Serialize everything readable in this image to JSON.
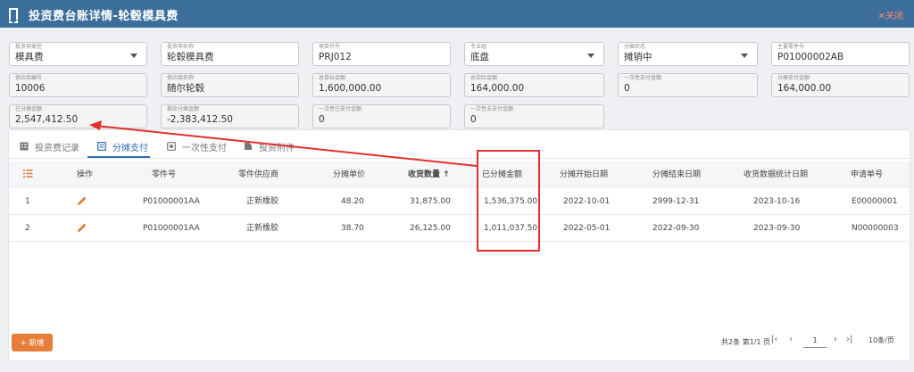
{
  "window": {
    "title": "投资费台账详情-轮毂模具费",
    "close_label": "✕关闭"
  },
  "form": {
    "row1": [
      {
        "label": "投资项类型",
        "value": "模具费",
        "dropdown": true
      },
      {
        "label": "投资项名称",
        "value": "轮毂模具费",
        "dropdown": false
      },
      {
        "label": "项目代号",
        "value": "PRJ012",
        "dropdown": false
      },
      {
        "label": "专业组",
        "value": "底盘",
        "dropdown": true
      },
      {
        "label": "分摊状态",
        "value": "摊销中",
        "dropdown": true
      },
      {
        "label": "主要零件号",
        "value": "P01000002AB",
        "dropdown": false
      }
    ],
    "row2": [
      {
        "label": "供应商编号",
        "value": "10006"
      },
      {
        "label": "供应商名称",
        "value": "随尔轮毂"
      },
      {
        "label": "总目标金额",
        "value": "1,600,000.00"
      },
      {
        "label": "总实际金额",
        "value": "164,000.00"
      },
      {
        "label": "一次性支付金额",
        "value": "0"
      },
      {
        "label": "分摊支付金额",
        "value": "164,000.00"
      }
    ],
    "row3": [
      {
        "label": "已分摊金额",
        "value": "2,547,412.50"
      },
      {
        "label": "剩余分摊金额",
        "value": "-2,383,412.50"
      },
      {
        "label": "一次性已支付金额",
        "value": "0"
      },
      {
        "label": "一次性未支付金额",
        "value": "0"
      }
    ]
  },
  "tabs": [
    {
      "label": "投资费记录",
      "icon": "records-icon",
      "active": false
    },
    {
      "label": "分摊支付",
      "icon": "calendar-icon",
      "active": true
    },
    {
      "label": "一次性支付",
      "icon": "payment-icon",
      "active": false
    },
    {
      "label": "投资附件",
      "icon": "attachment-icon",
      "active": false
    }
  ],
  "table": {
    "headers": [
      "操作",
      "零件号",
      "零件供应商",
      "分摊单价",
      "收货数量 ↑",
      "已分摊金额",
      "分摊开始日期",
      "分摊结束日期",
      "收货数据统计日期",
      "申请单号"
    ],
    "rows": [
      {
        "index": "1",
        "part": "P01000001AA",
        "supplier": "正新橡胶",
        "price": "48.20",
        "qty": "31,875.00",
        "amount": "1,536,375.00",
        "start": "2022-10-01",
        "end": "2999-12-31",
        "stat_date": "2023-10-16",
        "apply_no": "E00000001"
      },
      {
        "index": "2",
        "part": "P01000001AA",
        "supplier": "正新橡胶",
        "price": "38.70",
        "qty": "26,125.00",
        "amount": "1,011,037.50",
        "start": "2022-05-01",
        "end": "2022-09-30",
        "stat_date": "2023-09-30",
        "apply_no": "N00000003"
      }
    ]
  },
  "footer": {
    "add_label": "+ 新增",
    "summary": "共2条 第1/1 页",
    "page": "1",
    "page_size": "10条/页"
  },
  "colors": {
    "titlebar": "#3c6e9c",
    "accent": "#2f6db3",
    "orange": "#e67e3a",
    "highlight": "#e23030"
  }
}
